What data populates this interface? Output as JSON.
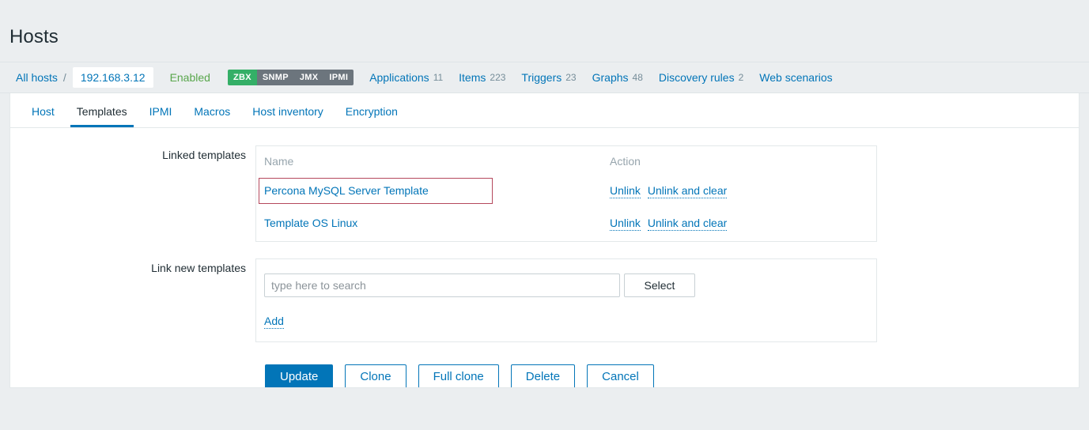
{
  "header": {
    "title": "Hosts"
  },
  "breadcrumb": {
    "all_hosts_label": "All hosts",
    "separator": "/",
    "host_name": "192.168.3.12",
    "status_label": "Enabled",
    "interfaces": [
      {
        "label": "ZBX",
        "active": true
      },
      {
        "label": "SNMP",
        "active": false
      },
      {
        "label": "JMX",
        "active": false
      },
      {
        "label": "IPMI",
        "active": false
      }
    ],
    "entity_links": [
      {
        "label": "Applications",
        "count": "11"
      },
      {
        "label": "Items",
        "count": "223"
      },
      {
        "label": "Triggers",
        "count": "23"
      },
      {
        "label": "Graphs",
        "count": "48"
      },
      {
        "label": "Discovery rules",
        "count": "2"
      },
      {
        "label": "Web scenarios",
        "count": ""
      }
    ]
  },
  "tabs": [
    {
      "label": "Host",
      "active": false
    },
    {
      "label": "Templates",
      "active": true
    },
    {
      "label": "IPMI",
      "active": false
    },
    {
      "label": "Macros",
      "active": false
    },
    {
      "label": "Host inventory",
      "active": false
    },
    {
      "label": "Encryption",
      "active": false
    }
  ],
  "form": {
    "linked_templates": {
      "label": "Linked templates",
      "columns": {
        "name": "Name",
        "action": "Action"
      },
      "rows": [
        {
          "name": "Percona MySQL Server Template",
          "highlighted": true,
          "unlink_label": "Unlink",
          "unlink_clear_label": "Unlink and clear"
        },
        {
          "name": "Template OS Linux",
          "highlighted": false,
          "unlink_label": "Unlink",
          "unlink_clear_label": "Unlink and clear"
        }
      ]
    },
    "link_new_templates": {
      "label": "Link new templates",
      "search_value": "",
      "search_placeholder": "type here to search",
      "select_button_label": "Select",
      "add_link_label": "Add"
    },
    "actions": [
      {
        "label": "Update",
        "style": "primary"
      },
      {
        "label": "Clone",
        "style": "secondary"
      },
      {
        "label": "Full clone",
        "style": "secondary"
      },
      {
        "label": "Delete",
        "style": "secondary"
      },
      {
        "label": "Cancel",
        "style": "secondary"
      }
    ]
  },
  "colors": {
    "accent": "#0275b8",
    "enabled": "#59a64c",
    "badge_active": "#34af67",
    "badge_inactive": "#6c757d",
    "highlight_border": "#b5485d",
    "page_background": "#ebeef0"
  }
}
